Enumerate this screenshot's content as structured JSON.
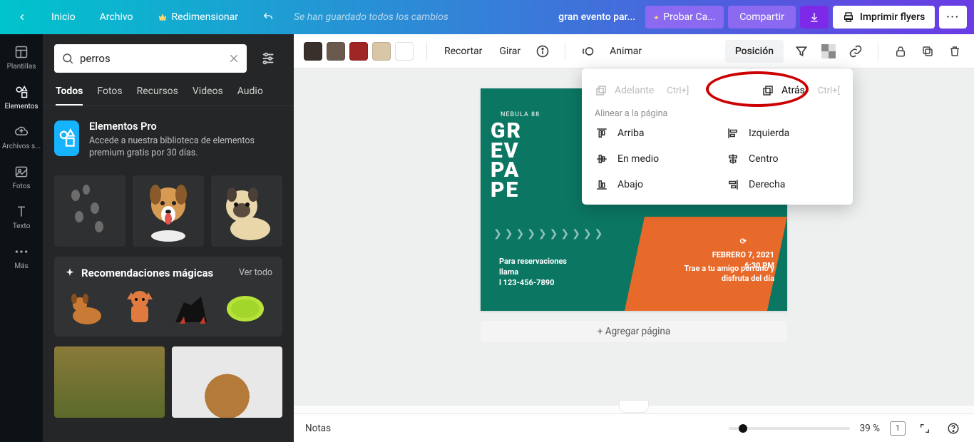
{
  "topbar": {
    "home": "Inicio",
    "file": "Archivo",
    "resize": "Redimensionar",
    "saved": "Se han guardado todos los cambios",
    "doc_title": "gran evento par...",
    "try": "Probar Ca...",
    "share": "Compartir",
    "print": "Imprimir flyers",
    "more": "···"
  },
  "rail": {
    "templates": "Plantillas",
    "elements": "Elementos",
    "uploads": "Archivos s...",
    "photos": "Fotos",
    "text": "Texto",
    "more": "Más"
  },
  "search": {
    "value": "perros"
  },
  "tabs": {
    "all": "Todos",
    "photos": "Fotos",
    "resources": "Recursos",
    "videos": "Videos",
    "audio": "Audio"
  },
  "pro": {
    "title": "Elementos Pro",
    "subtitle": "Accede a nuestra biblioteca de elementos premium gratis por 30 días."
  },
  "magic": {
    "title": "Recomendaciones mágicas",
    "see_all": "Ver todo"
  },
  "optsbar": {
    "swatches": [
      "#3a302b",
      "#6a5a4e",
      "#a02525",
      "#d8c6a6",
      "#ffffff"
    ],
    "crop": "Recortar",
    "rotate": "Girar",
    "animate": "Animar",
    "position": "Posición"
  },
  "position_popup": {
    "forward": "Adelante",
    "forward_sc": "Ctrl+]",
    "back": "Atrás",
    "back_sc": "Ctrl+[",
    "section": "Alinear a la página",
    "top": "Arriba",
    "left": "Izquierda",
    "middle": "En medio",
    "center": "Centro",
    "bottom": "Abajo",
    "right": "Derecha"
  },
  "page": {
    "brand": "NEBULA 88",
    "big1": "GR",
    "big2": "EV",
    "big3": "PA",
    "big4": "PE",
    "reservations1": "Para reservaciones",
    "reservations2": "llama",
    "reservations3": "l 123-456-7890",
    "date1": "FEBRERO 7, 2021",
    "date2": "6:30 PM",
    "msg1": "Trae a tu amigo perruno y",
    "msg2": "disfruta del día"
  },
  "add_page": "+ Agregar página",
  "bottom": {
    "notes": "Notas",
    "zoom": "39 %",
    "page_num": "1"
  }
}
